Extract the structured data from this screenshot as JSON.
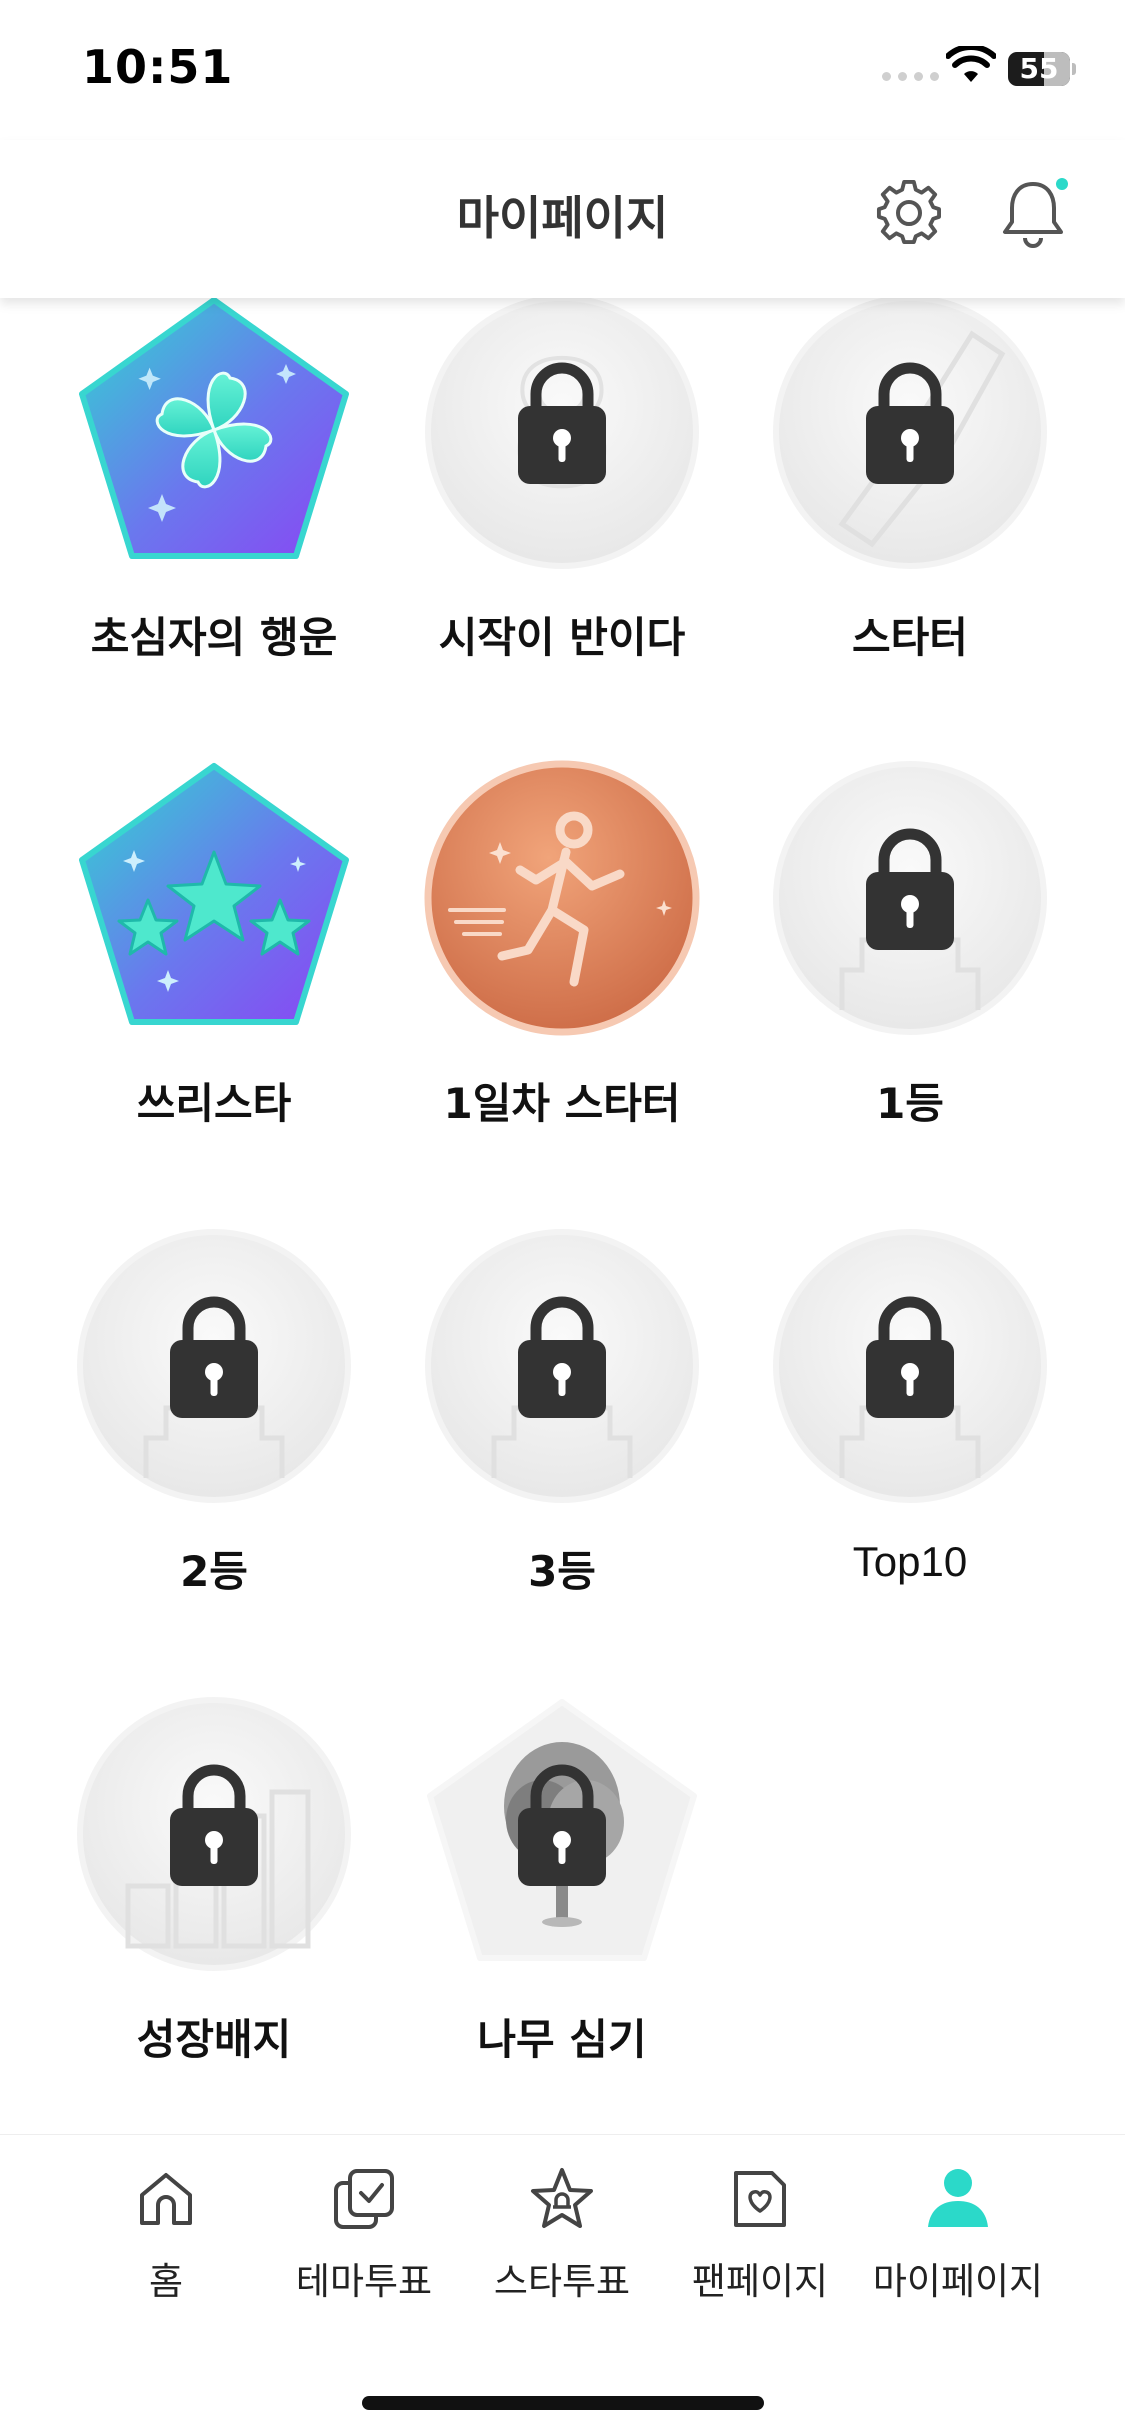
{
  "status_bar": {
    "time": "10:51",
    "battery_level": "55"
  },
  "header": {
    "title": "마이페이지"
  },
  "badges": [
    {
      "label": "초심자의 행운",
      "locked": false,
      "shape": "pentagon",
      "art": "clover"
    },
    {
      "label": "시작이 반이다",
      "locked": true,
      "shape": "circle"
    },
    {
      "label": "스타터",
      "locked": true,
      "shape": "circle"
    },
    {
      "label": "쓰리스타",
      "locked": false,
      "shape": "pentagon",
      "art": "three-stars"
    },
    {
      "label": "1일차 스타터",
      "locked": false,
      "shape": "circle",
      "art": "runner"
    },
    {
      "label": "1등",
      "locked": true,
      "shape": "circle"
    },
    {
      "label": "2등",
      "locked": true,
      "shape": "circle"
    },
    {
      "label": "3등",
      "locked": true,
      "shape": "circle"
    },
    {
      "label": "Top10",
      "locked": true,
      "shape": "circle"
    },
    {
      "label": "성장배지",
      "locked": true,
      "shape": "circle"
    },
    {
      "label": "나무 심기",
      "locked": true,
      "shape": "pentagon"
    }
  ],
  "nav": {
    "items": [
      {
        "label": "홈",
        "icon": "home-icon",
        "active": false
      },
      {
        "label": "테마투표",
        "icon": "theme-vote-icon",
        "active": false
      },
      {
        "label": "스타투표",
        "icon": "star-vote-icon",
        "active": false
      },
      {
        "label": "팬페이지",
        "icon": "fan-page-icon",
        "active": false
      },
      {
        "label": "마이페이지",
        "icon": "person-icon",
        "active": true
      }
    ]
  },
  "colors": {
    "accent": "#2bd9c9",
    "badge_gradient_top": "#3fe0c8",
    "badge_gradient_bottom": "#8a4df5",
    "bronze": "#d9825b",
    "lock": "#333333"
  }
}
